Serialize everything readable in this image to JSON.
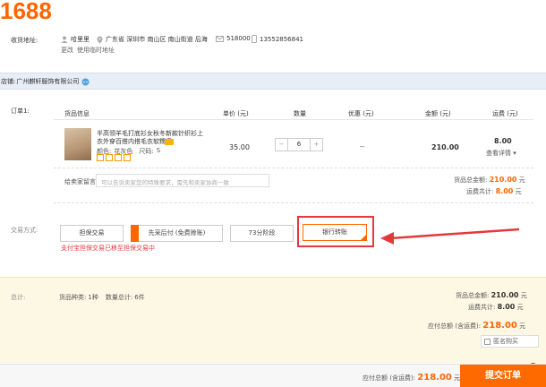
{
  "logo": "1688",
  "address": {
    "label": "收货地址:",
    "name": "哈里里",
    "region": "广东省 深圳市 南山区 南山街道 后海",
    "zip": "518000",
    "phone": "13552856841",
    "change_link": "更改",
    "temp_link": "使用临时地址"
  },
  "shop": {
    "label": "店铺:",
    "name": "广州麒轩服饰有限公司"
  },
  "order": {
    "label": "订单1:",
    "headers": {
      "item": "货品信息",
      "price": "单价 (元)",
      "qty": "数量",
      "discount": "优惠 (元)",
      "amount": "金额 (元)",
      "shipping": "运费 (元)"
    },
    "item": {
      "title": "半高领羊毛打底衫女秋冬新款针织衫上衣外穿百搭内搭毛衣软糯紧",
      "color_label": "颜色:",
      "color": "花灰色",
      "size_label": "尺码:",
      "size": "S",
      "price": "35.00",
      "qty": "6",
      "discount": "--",
      "amount": "210.00",
      "shipping": "8.00",
      "shipping_detail": "查看详情"
    },
    "message_label": "给卖家留言:",
    "message_placeholder": "可以告诉卖家您的特殊要求，需先和卖家协商一致",
    "goods_total_label": "货品总金额:",
    "goods_total": "210.00",
    "goods_total_unit": "元",
    "shipping_total_label": "运费共计:",
    "shipping_total": "8.00",
    "shipping_total_unit": "元"
  },
  "trade": {
    "label": "交易方式:",
    "options": [
      "担保交易",
      "先采后付 (免费赊账)",
      "73分阶段",
      "银行转账"
    ],
    "note": "支付宝担保交易已移至担保交易中"
  },
  "summary": {
    "label": "总计:",
    "kinds_label": "货品种类:",
    "kinds": "1种",
    "count_label": "数量总计:",
    "count": "6件",
    "goods_label": "货品总金额:",
    "goods": "210.00",
    "goods_unit": "元",
    "shipping_label": "运费共计:",
    "shipping": "8.00",
    "shipping_unit": "元",
    "payable_label": "应付总额 (含运费):",
    "payable": "218.00",
    "payable_unit": "元",
    "anon_label": "匿名购买"
  },
  "footer": {
    "payable_label": "应付总额 (含运费):",
    "payable": "218.00",
    "unit": "元",
    "submit": "提交订单"
  },
  "colors": {
    "accent": "#ff6600",
    "highlight": "#e4393c",
    "price_red": "#e4393c"
  }
}
